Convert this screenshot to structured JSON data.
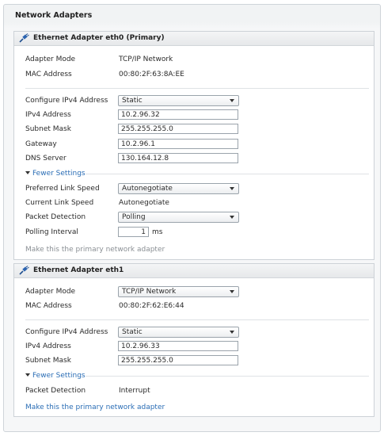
{
  "page": {
    "title": "Network Adapters"
  },
  "adapters": [
    {
      "title": "Ethernet Adapter eth0 (Primary)",
      "adapter_mode_label": "Adapter Mode",
      "adapter_mode_value": "TCP/IP Network",
      "mac_label": "MAC Address",
      "mac_value": "00:80:2F:63:8A:EE",
      "ipv4_config_label": "Configure IPv4 Address",
      "ipv4_config_value": "Static",
      "ipv4_label": "IPv4 Address",
      "ipv4_value": "10.2.96.32",
      "subnet_label": "Subnet Mask",
      "subnet_value": "255.255.255.0",
      "gateway_label": "Gateway",
      "gateway_value": "10.2.96.1",
      "dns_label": "DNS Server",
      "dns_value": "130.164.12.8",
      "fewer_settings": "Fewer Settings",
      "pref_link_label": "Preferred Link Speed",
      "pref_link_value": "Autonegotiate",
      "current_link_label": "Current Link Speed",
      "current_link_value": "Autonegotiate",
      "packet_label": "Packet Detection",
      "packet_value": "Polling",
      "polling_label": "Polling Interval",
      "polling_value": "1",
      "polling_unit": "ms",
      "primary_link": "Make this the primary network adapter"
    },
    {
      "title": "Ethernet Adapter eth1",
      "adapter_mode_label": "Adapter Mode",
      "adapter_mode_value": "TCP/IP Network",
      "mac_label": "MAC Address",
      "mac_value": "00:80:2F:62:E6:44",
      "ipv4_config_label": "Configure IPv4 Address",
      "ipv4_config_value": "Static",
      "ipv4_label": "IPv4 Address",
      "ipv4_value": "10.2.96.33",
      "subnet_label": "Subnet Mask",
      "subnet_value": "255.255.255.0",
      "fewer_settings": "Fewer Settings",
      "packet_label": "Packet Detection",
      "packet_value": "Interrupt",
      "primary_link": "Make this the primary network adapter"
    }
  ],
  "colors": {
    "link": "#2a6db5",
    "disabled_text": "#8a8f94",
    "panel_border": "#cdd2d7"
  },
  "icons": {
    "adapter_icon": "network-plug-icon",
    "dropdown_icon": "chevron-down-icon",
    "toggle_icon": "triangle-down-icon"
  }
}
